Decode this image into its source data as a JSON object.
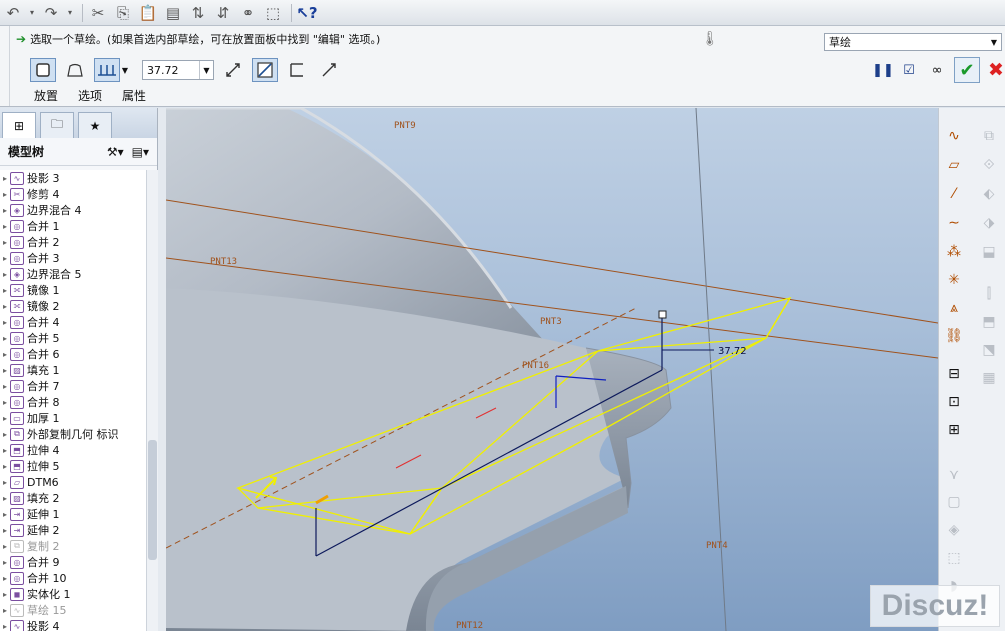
{
  "toolbar": {
    "icons": [
      "undo-icon",
      "dropdown-icon",
      "redo-icon",
      "dropdown-icon",
      "cut-icon",
      "copy-icon",
      "paste-icon",
      "paste-special-icon",
      "regenerate-icon",
      "regenerate-manager-icon",
      "find-icon",
      "select-box-icon",
      "context-help-icon"
    ]
  },
  "dashboard": {
    "prompt": "选取一个草绘。(如果首选内部草绘，可在放置面板中找到 \"编辑\" 选项。)",
    "mode_select": "草绘",
    "depth_value": "37.72",
    "tabs": [
      "放置",
      "选项",
      "属性"
    ]
  },
  "model_tree": {
    "title": "模型树",
    "items": [
      {
        "label": "投影 3",
        "icon": "project",
        "dim": false
      },
      {
        "label": "修剪 4",
        "icon": "trim",
        "dim": false
      },
      {
        "label": "边界混合 4",
        "icon": "boundary",
        "dim": false
      },
      {
        "label": "合并 1",
        "icon": "merge",
        "dim": false
      },
      {
        "label": "合并 2",
        "icon": "merge",
        "dim": false
      },
      {
        "label": "合并 3",
        "icon": "merge",
        "dim": false
      },
      {
        "label": "边界混合 5",
        "icon": "boundary",
        "dim": false
      },
      {
        "label": "镜像 1",
        "icon": "mirror",
        "dim": false
      },
      {
        "label": "镜像 2",
        "icon": "mirror",
        "dim": false
      },
      {
        "label": "合并 4",
        "icon": "merge",
        "dim": false
      },
      {
        "label": "合并 5",
        "icon": "merge",
        "dim": false
      },
      {
        "label": "合并 6",
        "icon": "merge",
        "dim": false
      },
      {
        "label": "填充 1",
        "icon": "fill",
        "dim": false
      },
      {
        "label": "合并 7",
        "icon": "merge",
        "dim": false
      },
      {
        "label": "合并 8",
        "icon": "merge",
        "dim": false
      },
      {
        "label": "加厚 1",
        "icon": "thicken",
        "dim": false
      },
      {
        "label": "外部复制几何 标识",
        "icon": "copygeom",
        "dim": false
      },
      {
        "label": "拉伸 4",
        "icon": "extrude",
        "dim": false
      },
      {
        "label": "拉伸 5",
        "icon": "extrude",
        "dim": false
      },
      {
        "label": "DTM6",
        "icon": "plane",
        "dim": false
      },
      {
        "label": "填充 2",
        "icon": "fill",
        "dim": false
      },
      {
        "label": "延伸 1",
        "icon": "extend",
        "dim": false
      },
      {
        "label": "延伸 2",
        "icon": "extend",
        "dim": false
      },
      {
        "label": "复制 2",
        "icon": "copy",
        "dim": true
      },
      {
        "label": "合并 9",
        "icon": "merge",
        "dim": false
      },
      {
        "label": "合并 10",
        "icon": "merge",
        "dim": false
      },
      {
        "label": "实体化 1",
        "icon": "solidify",
        "dim": false
      },
      {
        "label": "草绘 15",
        "icon": "sketch",
        "dim": true
      },
      {
        "label": "投影 4",
        "icon": "project",
        "dim": false
      }
    ]
  },
  "viewport": {
    "points": [
      "PNT9",
      "PNT13",
      "PNT3",
      "PNT16",
      "PNT4",
      "PNT12"
    ],
    "dimension": "37.72"
  },
  "watermark": "Discuz!",
  "colors": {
    "accent": "#1a9a2b",
    "cancel": "#dd2222",
    "preview": "#f0f000",
    "datum": "#b05a1c",
    "surface": "#b8c0cb"
  }
}
